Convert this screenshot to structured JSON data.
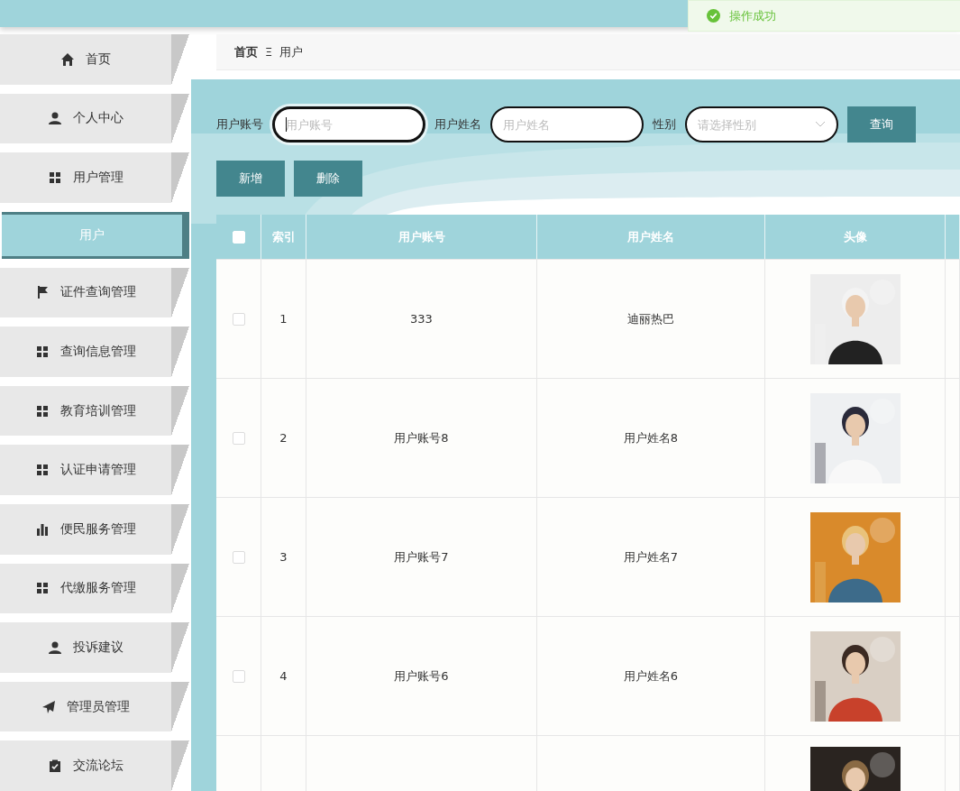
{
  "toast": {
    "kind": "success",
    "message": "操作成功"
  },
  "sidebar": {
    "items": [
      {
        "label": "首页",
        "kind": "home",
        "selected": false
      },
      {
        "label": "个人中心",
        "kind": "user",
        "selected": false
      },
      {
        "label": "用户管理",
        "kind": "grid",
        "selected": false
      },
      {
        "label": "用户",
        "kind": "plain",
        "selected": true
      },
      {
        "label": "证件查询管理",
        "kind": "flag",
        "selected": false
      },
      {
        "label": "查询信息管理",
        "kind": "grid",
        "selected": false
      },
      {
        "label": "教育培训管理",
        "kind": "grid",
        "selected": false
      },
      {
        "label": "认证申请管理",
        "kind": "grid",
        "selected": false
      },
      {
        "label": "便民服务管理",
        "kind": "bars",
        "selected": false
      },
      {
        "label": "代缴服务管理",
        "kind": "grid",
        "selected": false
      },
      {
        "label": "投诉建议",
        "kind": "user",
        "selected": false
      },
      {
        "label": "管理员管理",
        "kind": "plane",
        "selected": false
      },
      {
        "label": "交流论坛",
        "kind": "clipboard",
        "selected": false
      }
    ]
  },
  "breadcrumb": [
    "首页",
    "用户"
  ],
  "breadcrumb_separator": "Ξ",
  "search": {
    "fields": [
      {
        "label": "用户账号",
        "placeholder": "用户账号",
        "kind": "input",
        "focused": true
      },
      {
        "label": "用户姓名",
        "placeholder": "用户姓名",
        "kind": "input",
        "focused": false
      },
      {
        "label": "性别",
        "placeholder": "请选择性别",
        "kind": "select",
        "focused": false
      }
    ],
    "button": "查询"
  },
  "actions": [
    "新增",
    "删除"
  ],
  "table": {
    "select_all_checked": false,
    "columns": [
      "索引",
      "用户账号",
      "用户姓名",
      "头像"
    ],
    "rows": [
      {
        "index": "1",
        "account": "333",
        "name": "迪丽热巴",
        "checked": false,
        "avatar": {
          "kind": "picture"
        }
      },
      {
        "index": "2",
        "account": "用户账号8",
        "name": "用户姓名8",
        "checked": false,
        "avatar": {
          "kind": "picture"
        }
      },
      {
        "index": "3",
        "account": "用户账号7",
        "name": "用户姓名7",
        "checked": false,
        "avatar": {
          "kind": "picture"
        }
      },
      {
        "index": "4",
        "account": "用户账号6",
        "name": "用户姓名6",
        "checked": false,
        "avatar": {
          "kind": "picture"
        }
      },
      {
        "avatar": {
          "kind": "picture"
        }
      }
    ]
  }
}
